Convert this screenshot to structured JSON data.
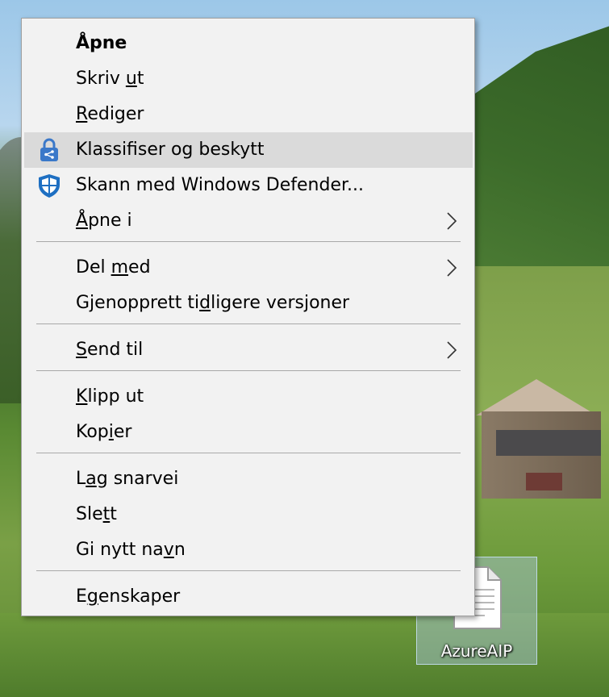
{
  "desktop": {
    "icon_label": "AzureAIP",
    "icon_name": "document-file-icon"
  },
  "context_menu": {
    "highlight_color": "#dadada",
    "background_color": "#f2f2f2",
    "items": [
      {
        "label": "Åpne",
        "bold": true
      },
      {
        "label": "Skriv ut",
        "access_key": "u"
      },
      {
        "label": "Rediger",
        "access_key": "R"
      },
      {
        "label": "Klassifiser og beskytt",
        "icon": "azure-information-protection-lock-icon",
        "highlighted": true
      },
      {
        "label": "Skann med Windows Defender...",
        "icon": "windows-defender-shield-icon"
      },
      {
        "label": "Åpne i",
        "access_key": "Å",
        "submenu": true
      },
      {
        "label": "Del med",
        "access_key": "m",
        "submenu": true
      },
      {
        "label": "Gjenopprett tidligere versjoner",
        "access_key": "d"
      },
      {
        "label": "Send til",
        "access_key": "S",
        "submenu": true
      },
      {
        "label": "Klipp ut",
        "access_key": "K"
      },
      {
        "label": "Kopier",
        "access_key": "i"
      },
      {
        "label": "Lag snarvei",
        "access_key": "a"
      },
      {
        "label": "Slett",
        "access_key": "t"
      },
      {
        "label": "Gi nytt navn",
        "access_key": "v"
      },
      {
        "label": "Egenskaper",
        "access_key": "g"
      }
    ]
  }
}
